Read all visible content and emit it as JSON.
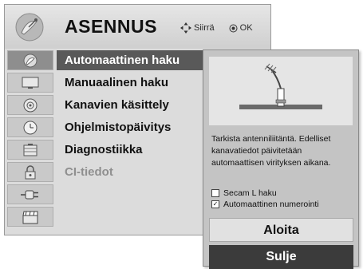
{
  "menu": {
    "title": "ASENNUS",
    "hint_move": "Siirrä",
    "hint_ok": "OK",
    "items": [
      {
        "label": "Automaattinen haku",
        "selected": true
      },
      {
        "label": "Manuaalinen haku"
      },
      {
        "label": "Kanavien käsittely"
      },
      {
        "label": "Ohjelmistopäivitys"
      },
      {
        "label": "Diagnostiikka"
      },
      {
        "label": "CI-tiedot",
        "disabled": true
      }
    ],
    "sidebar_icons": [
      "satellite-dish-icon",
      "tv-screen-icon",
      "speaker-icon",
      "clock-icon",
      "lock-icon",
      "padlock-icon",
      "plug-icon",
      "clapper-icon"
    ]
  },
  "popup": {
    "description": "Tarkista antenniliitäntä. Edelliset kanavatiedot päivitetään automaattisen virityksen aikana.",
    "option1": {
      "label": "Secam L haku",
      "checked": false
    },
    "option2": {
      "label": "Automaattinen numerointi",
      "checked": true
    },
    "start_label": "Aloita",
    "close_label": "Sulje"
  },
  "colors": {
    "selected": "#595959",
    "close_button": "#3b3b3b",
    "panel": "#dcdcdc"
  }
}
